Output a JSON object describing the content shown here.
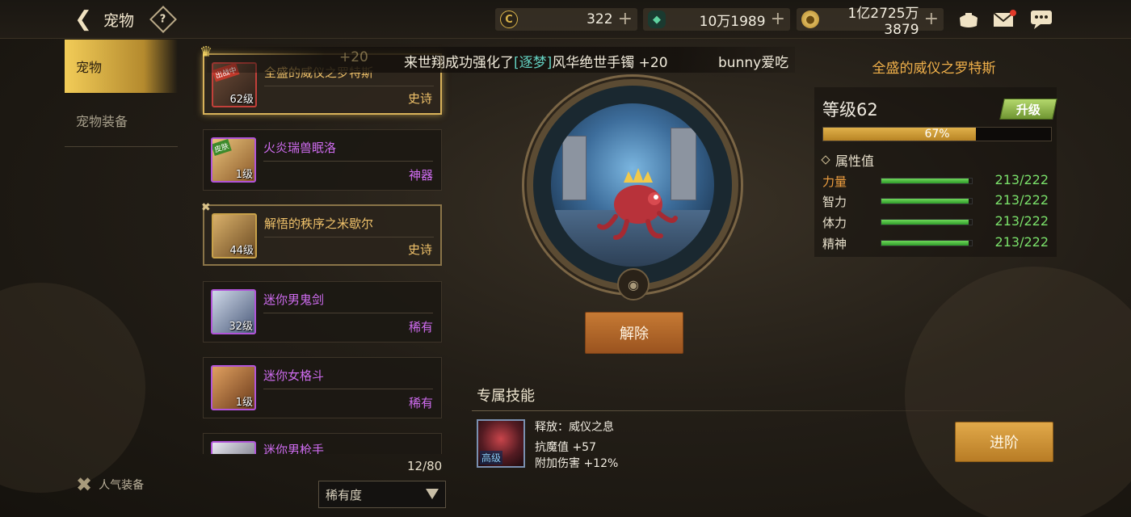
{
  "header": {
    "title": "宠物",
    "help": "?",
    "currencies": [
      {
        "icon": "gold-c-coin-icon",
        "value": "322"
      },
      {
        "icon": "green-crystal-icon",
        "value": "10万1989"
      },
      {
        "icon": "gold-coin-icon",
        "value": "1亿2725万3879"
      }
    ],
    "plus": "+"
  },
  "nav": {
    "items": [
      {
        "label": "宠物",
        "active": true
      },
      {
        "label": "宠物装备",
        "active": false
      }
    ],
    "popular_equipment": "人气装备"
  },
  "ticker": {
    "ghost": "+20",
    "msg_prefix": "来世翔成功强化了",
    "msg_item": "[逐梦]",
    "msg_suffix": "风华绝世手镯 +20",
    "msg2": "bunny爱吃"
  },
  "pets": [
    {
      "name": "全盛的威仪之罗特斯",
      "level": "62级",
      "rarity": "史诗",
      "badge": "出战中",
      "state": "selected",
      "color": "gold"
    },
    {
      "name": "火炎瑞兽眠洛",
      "level": "1级",
      "rarity": "神器",
      "badge": "皮肤",
      "state": "normal",
      "color": "purple"
    },
    {
      "name": "解悟的秩序之米歇尔",
      "level": "44级",
      "rarity": "史诗",
      "badge": "",
      "state": "equipped",
      "color": "gold"
    },
    {
      "name": "迷你男鬼剑",
      "level": "32级",
      "rarity": "稀有",
      "badge": "",
      "state": "normal",
      "color": "purple"
    },
    {
      "name": "迷你女格斗",
      "level": "1级",
      "rarity": "稀有",
      "badge": "",
      "state": "normal",
      "color": "purple"
    },
    {
      "name": "迷你男枪手",
      "level": "",
      "rarity": "",
      "badge": "",
      "state": "normal",
      "color": "purple"
    }
  ],
  "list": {
    "count": "12/80",
    "sort_label": "稀有度"
  },
  "actions": {
    "release": "解除",
    "advance": "进阶",
    "upgrade": "升级"
  },
  "skill": {
    "section_title": "专属技能",
    "grade": "高级",
    "name": "释放：威仪之息",
    "line1": "抗魔值 +57",
    "line2": "附加伤害 +12%"
  },
  "detail": {
    "pet_name": "全盛的威仪之罗特斯",
    "level": "等级62",
    "exp_percent": 67,
    "exp_label": "67%",
    "attr_title": "属性值",
    "stats": [
      {
        "label": "力量",
        "value": "213/222",
        "ratio": 0.96,
        "highlight": true
      },
      {
        "label": "智力",
        "value": "213/222",
        "ratio": 0.96,
        "highlight": false
      },
      {
        "label": "体力",
        "value": "213/222",
        "ratio": 0.96,
        "highlight": false
      },
      {
        "label": "精神",
        "value": "213/222",
        "ratio": 0.96,
        "highlight": false
      }
    ]
  },
  "colors": {
    "accent_gold": "#f0c26a",
    "epic_purple": "#cf6cf0",
    "stat_green": "#7ae06a",
    "release_orange": "#c67a34",
    "advance_gold": "#e1a94a"
  }
}
